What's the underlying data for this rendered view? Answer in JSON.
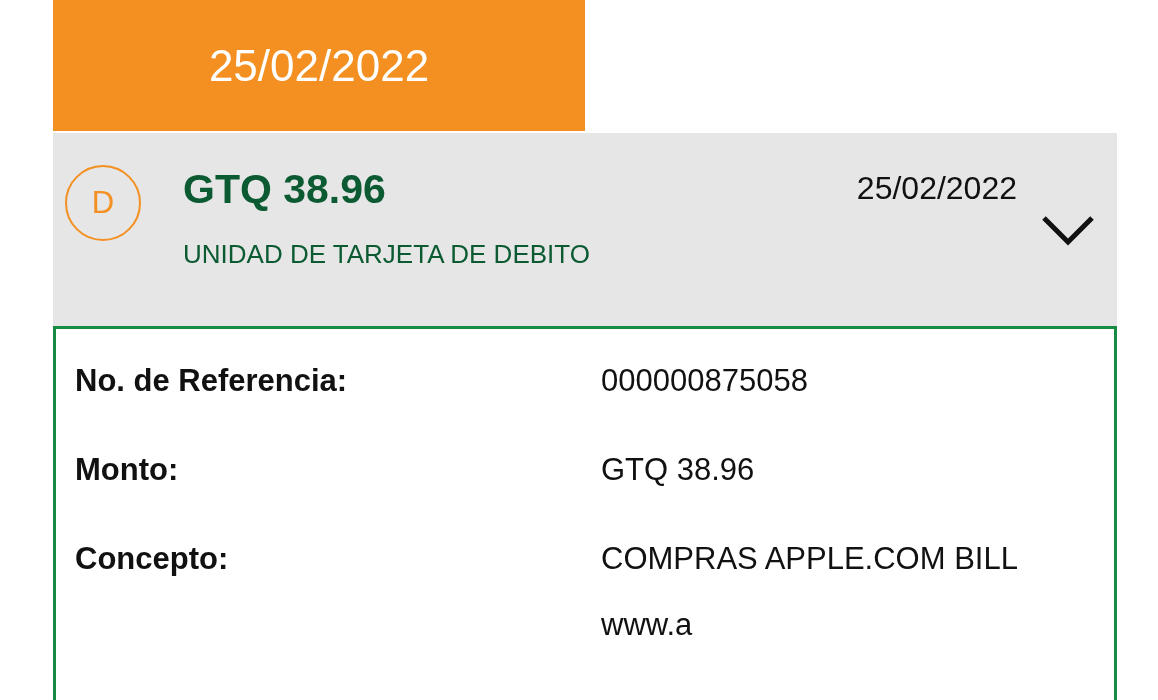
{
  "date_tab": {
    "label": "25/02/2022"
  },
  "transaction": {
    "type_letter": "D",
    "amount": "GTQ 38.96",
    "description": "UNIDAD DE TARJETA DE DEBITO",
    "date": "25/02/2022",
    "expanded": true
  },
  "details": [
    {
      "label": "No. de Referencia:",
      "value": "000000875058"
    },
    {
      "label": "Monto:",
      "value": "GTQ 38.96"
    },
    {
      "label": "Concepto:",
      "value": "COMPRAS APPLE.COM BILL www.a"
    }
  ]
}
